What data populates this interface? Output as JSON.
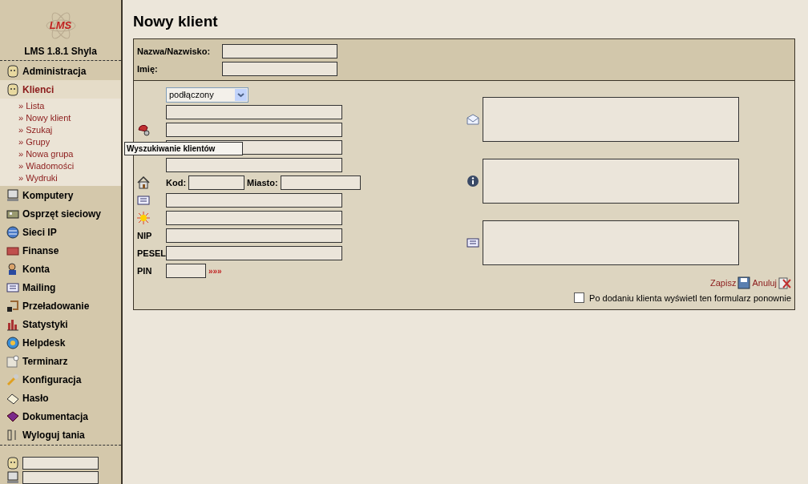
{
  "sidebar": {
    "logo_text": "LMS",
    "version": "LMS 1.8.1 Shyla",
    "items": [
      {
        "label": "Administracja",
        "selected": false
      },
      {
        "label": "Klienci",
        "selected": true,
        "children": [
          {
            "label": "» Lista"
          },
          {
            "label": "» Nowy klient"
          },
          {
            "label": "» Szukaj"
          },
          {
            "label": "» Grupy"
          },
          {
            "label": "» Nowa grupa"
          },
          {
            "label": "» Wiadomości"
          },
          {
            "label": "» Wydruki"
          }
        ]
      },
      {
        "label": "Komputery",
        "selected": false
      },
      {
        "label": "Osprzęt sieciowy",
        "selected": false
      },
      {
        "label": "Sieci IP",
        "selected": false
      },
      {
        "label": "Finanse",
        "selected": false
      },
      {
        "label": "Konta",
        "selected": false
      },
      {
        "label": "Mailing",
        "selected": false
      },
      {
        "label": "Przeładowanie",
        "selected": false
      },
      {
        "label": "Statystyki",
        "selected": false
      },
      {
        "label": "Helpdesk",
        "selected": false
      },
      {
        "label": "Terminarz",
        "selected": false
      },
      {
        "label": "Konfiguracja",
        "selected": false
      },
      {
        "label": "Hasło",
        "selected": false
      },
      {
        "label": "Dokumentacja",
        "selected": false
      },
      {
        "label": "Wyloguj tania",
        "selected": false
      }
    ]
  },
  "page_title": "Nowy klient",
  "form": {
    "name_label": "Nazwa/Nazwisko:",
    "first_name_label": "Imię:",
    "status": "podłączony",
    "postcode_label": "Kod:",
    "city_label": "Miasto:",
    "nip_label": "NIP",
    "pesel_label": "PESEL",
    "pin_label": "PIN",
    "pin_link": "»»»",
    "save": "Zapisz",
    "cancel": "Anuluj",
    "repeat_checkbox": {
      "label": "Po dodaniu klienta wyświetl ten formularz ponownie",
      "checked": false
    }
  },
  "tooltip": "Wyszukiwanie klientów"
}
